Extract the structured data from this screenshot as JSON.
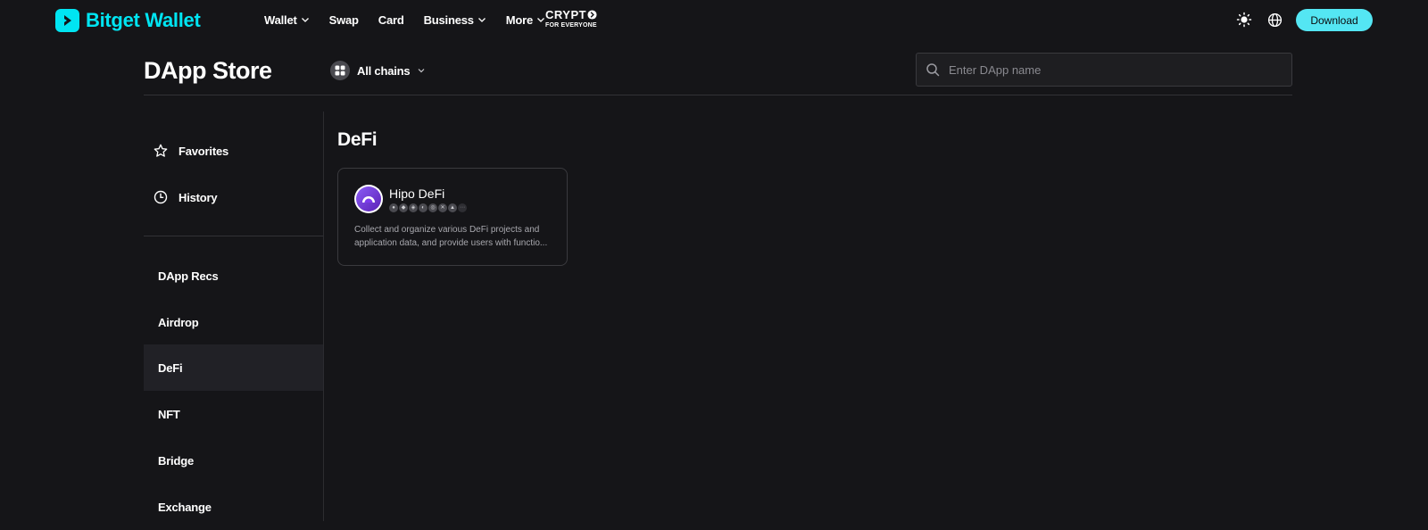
{
  "brand": {
    "name": "Bitget Wallet",
    "accent": "#00e5f2",
    "logo_icon": "play-chevron-icon"
  },
  "nav": {
    "items": [
      {
        "label": "Wallet",
        "has_dropdown": true
      },
      {
        "label": "Swap",
        "has_dropdown": false
      },
      {
        "label": "Card",
        "has_dropdown": false
      },
      {
        "label": "Business",
        "has_dropdown": true
      },
      {
        "label": "More",
        "has_dropdown": true
      }
    ],
    "badge": {
      "line1": "CRYPT",
      "line2": "FOR EVERYONE"
    }
  },
  "header_actions": {
    "theme_icon": "sun-icon",
    "language_icon": "globe-icon",
    "download_label": "Download",
    "download_color": "#54e6f3"
  },
  "store": {
    "title": "DApp Store",
    "chain_selector": {
      "label": "All chains",
      "icon": "grid-icon"
    },
    "search": {
      "placeholder": "Enter DApp name",
      "value": ""
    }
  },
  "sidebar": {
    "top_items": [
      {
        "label": "Favorites",
        "icon": "star-icon"
      },
      {
        "label": "History",
        "icon": "clock-icon"
      }
    ],
    "categories": [
      {
        "label": "DApp Recs",
        "active": false
      },
      {
        "label": "Airdrop",
        "active": false
      },
      {
        "label": "DeFi",
        "active": true
      },
      {
        "label": "NFT",
        "active": false
      },
      {
        "label": "Bridge",
        "active": false
      },
      {
        "label": "Exchange",
        "active": false
      }
    ]
  },
  "main": {
    "section_title": "DeFi",
    "cards": [
      {
        "name": "Hipo DeFi",
        "icon": "hipo-logo-icon",
        "desc_line1": "Collect and organize various DeFi projects and",
        "desc_line2": "application data, and provide users with functio..."
      }
    ]
  }
}
